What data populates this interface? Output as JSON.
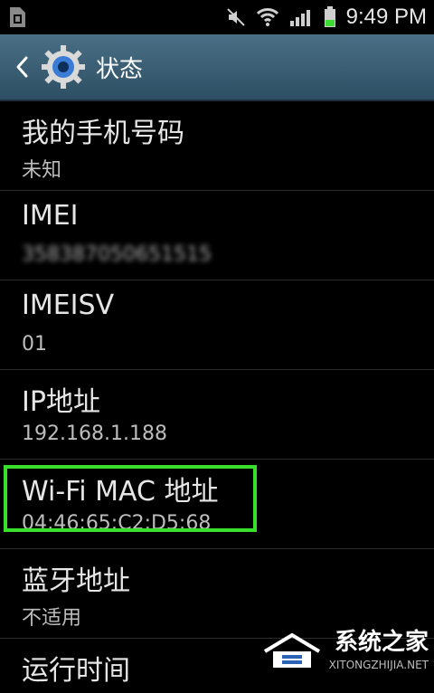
{
  "status_bar": {
    "time": "9:49 PM"
  },
  "app_bar": {
    "title": "状态"
  },
  "items": [
    {
      "label": "我的手机号码",
      "value": "未知"
    },
    {
      "label": "IMEI",
      "value": "358387050651515"
    },
    {
      "label": "IMEISV",
      "value": "01"
    },
    {
      "label": "IP地址",
      "value": "192.168.1.188"
    },
    {
      "label": "Wi-Fi MAC 地址",
      "value": "04:46:65:C2:D5:68"
    },
    {
      "label": "蓝牙地址",
      "value": "不适用"
    },
    {
      "label": "运行时间",
      "value": ""
    }
  ],
  "watermark": {
    "text": "系统之家",
    "subtext": "XITONGZHIJIA.NET"
  },
  "colors": {
    "appbar": "#3f6479",
    "highlight": "#38e02b"
  }
}
